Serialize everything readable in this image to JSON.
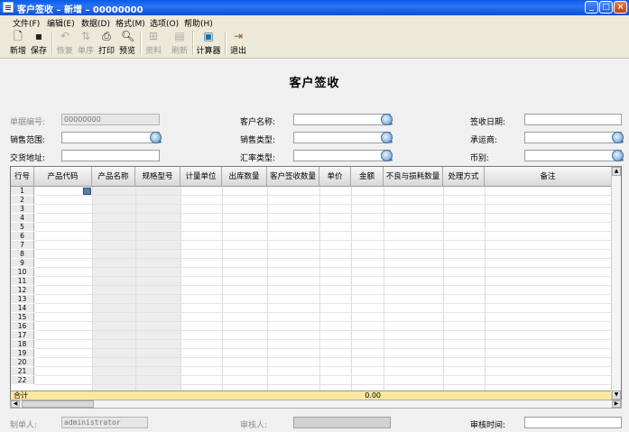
{
  "window": {
    "title": "客户签收 – 新增 – 00000000",
    "minimize": "_",
    "maximize": "□",
    "close": "×"
  },
  "menu": [
    "文件(F)",
    "编辑(E)",
    "数据(D)",
    "格式(M)",
    "选项(O)",
    "帮助(H)"
  ],
  "toolbar": {
    "new": "新增",
    "save": "保存",
    "restore": "恢复",
    "order": "单序",
    "print": "打印",
    "preview": "预览",
    "material": "资料",
    "refresh": "刷新",
    "calculator": "计算器",
    "exit": "退出"
  },
  "form": {
    "title": "客户签收",
    "doc_no_label": "单据编号:",
    "doc_no_value": "00000000",
    "customer_name_label": "客户名称:",
    "sign_date_label": "签收日期:",
    "sales_range_label": "销售范围:",
    "sales_type_label": "销售类型:",
    "carrier_label": "承运商:",
    "delivery_addr_label": "交货地址:",
    "rate_type_label": "汇率类型:",
    "currency_label": "币别:"
  },
  "grid": {
    "columns": [
      "行号",
      "产品代码",
      "产品名称",
      "规格型号",
      "计量单位",
      "出库数量",
      "客户签收数量",
      "单价",
      "金额",
      "不良与损耗数量",
      "处理方式",
      "备注"
    ],
    "rows": [
      "1",
      "2",
      "3",
      "4",
      "5",
      "6",
      "7",
      "8",
      "9",
      "10",
      "11",
      "12",
      "13",
      "14",
      "15",
      "16",
      "17",
      "18",
      "19",
      "20",
      "21",
      "22"
    ],
    "total_label": "合计",
    "total_amount": "0.00"
  },
  "footer": {
    "maker_label": "制单人:",
    "maker_value": "administrator",
    "reviewer_label": "审核人:",
    "review_time_label": "审核时间:"
  }
}
